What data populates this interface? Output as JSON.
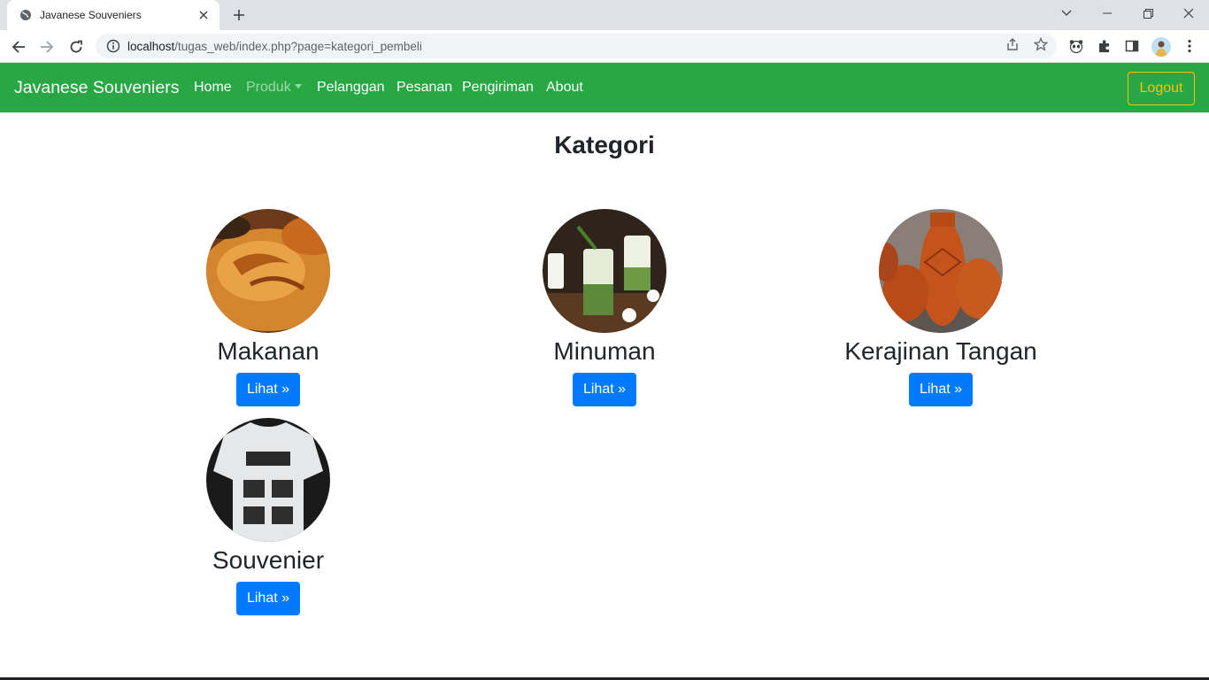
{
  "browser": {
    "tab_title": "Javanese Souveniers",
    "url_host": "localhost",
    "url_rest": "/tugas_web/index.php?page=kategori_pembeli"
  },
  "navbar": {
    "brand": "Javanese Souveniers",
    "links": [
      "Home",
      "Produk",
      "Pelanggan",
      "Pesanan",
      "Pengiriman",
      "About"
    ],
    "logout": "Logout",
    "bg_color": "#28a745",
    "logout_color": "#ffc107"
  },
  "page": {
    "title": "Kategori",
    "categories": [
      {
        "name": "Makanan",
        "button": "Lihat »"
      },
      {
        "name": "Minuman",
        "button": "Lihat »"
      },
      {
        "name": "Kerajinan Tangan",
        "button": "Lihat »"
      },
      {
        "name": "Souvenier",
        "button": "Lihat »"
      }
    ],
    "button_color": "#007bff"
  }
}
